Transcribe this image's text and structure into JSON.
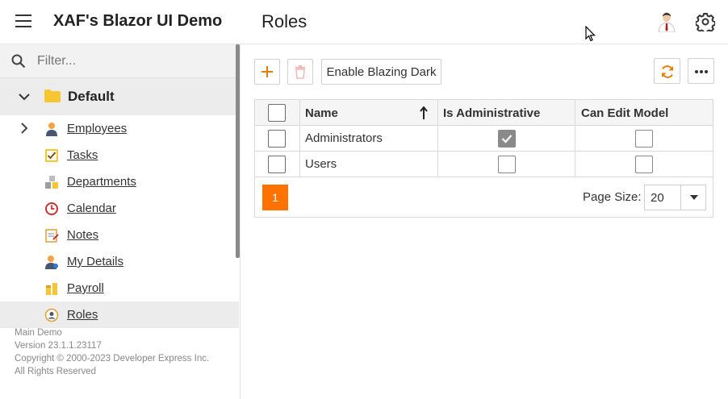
{
  "header": {
    "app_title": "XAF's Blazor UI Demo",
    "page_title": "Roles"
  },
  "sidebar": {
    "filter_placeholder": "Filter...",
    "group_label": "Default",
    "items": [
      {
        "label": "Employees",
        "icon": "employee-icon"
      },
      {
        "label": "Tasks",
        "icon": "tasks-icon"
      },
      {
        "label": "Departments",
        "icon": "departments-icon"
      },
      {
        "label": "Calendar",
        "icon": "calendar-icon"
      },
      {
        "label": "Notes",
        "icon": "notes-icon"
      },
      {
        "label": "My Details",
        "icon": "my-details-icon"
      },
      {
        "label": "Payroll",
        "icon": "payroll-icon"
      },
      {
        "label": "Roles",
        "icon": "roles-icon"
      }
    ],
    "selected": "Roles",
    "footer": {
      "line1": "Main Demo",
      "line2": "Version 23.1.1.23117",
      "line3": "Copyright © 2000-2023 Developer Express Inc.",
      "line4": "All Rights Reserved"
    }
  },
  "toolbar": {
    "new_icon": "plus-icon",
    "delete_icon": "trash-icon",
    "dark_label": "Enable Blazing Dark",
    "refresh_icon": "refresh-icon",
    "more_icon": "more-icon"
  },
  "grid": {
    "columns": [
      "Name",
      "Is Administrative",
      "Can Edit Model"
    ],
    "sort_column": "Name",
    "rows": [
      {
        "name": "Administrators",
        "is_administrative": true,
        "can_edit_model": false
      },
      {
        "name": "Users",
        "is_administrative": false,
        "can_edit_model": false
      }
    ],
    "pager": {
      "current_page": "1",
      "page_size_label": "Page Size:",
      "page_size": "20"
    }
  },
  "colors": {
    "accent": "#ff7200",
    "selected_bg": "#ececec"
  }
}
